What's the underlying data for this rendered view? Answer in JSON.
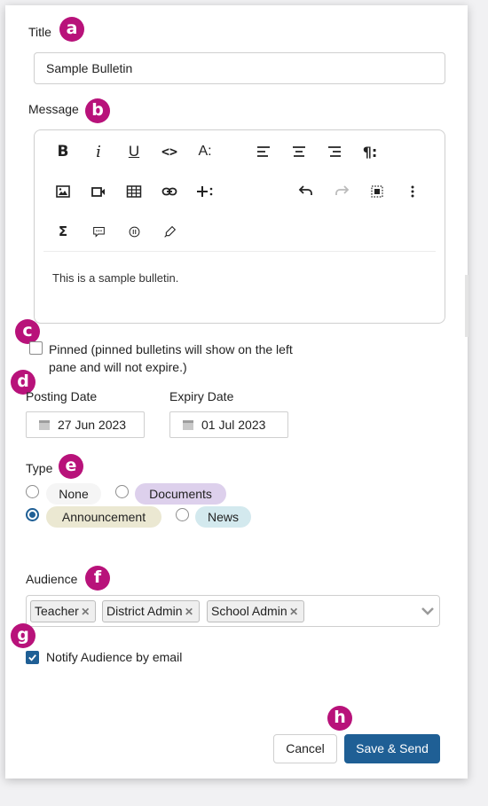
{
  "markers": [
    "a",
    "b",
    "c",
    "d",
    "e",
    "f",
    "g",
    "h"
  ],
  "title_field": {
    "label": "Title",
    "value": "Sample Bulletin"
  },
  "message": {
    "label": "Message",
    "body": "This is a sample bulletin.",
    "toolbar": [
      {
        "name": "bold-button",
        "icon": "bold-icon",
        "glyph": "B"
      },
      {
        "name": "italic-button",
        "icon": "italic-icon",
        "glyph": "i"
      },
      {
        "name": "underline-button",
        "icon": "underline-icon",
        "glyph": "U"
      },
      {
        "name": "code-button",
        "icon": "code-icon",
        "glyph": "<>"
      },
      {
        "name": "font-size-button",
        "icon": "font-size-icon",
        "glyph": "A:"
      },
      {
        "name": "align-left-button",
        "icon": "align-left-icon"
      },
      {
        "name": "align-center-button",
        "icon": "align-center-icon"
      },
      {
        "name": "align-right-button",
        "icon": "align-right-icon"
      },
      {
        "name": "paragraph-format-button",
        "icon": "paragraph-icon",
        "glyph": "¶:"
      },
      {
        "name": "insert-image-button",
        "icon": "image-icon"
      },
      {
        "name": "insert-video-button",
        "icon": "video-icon"
      },
      {
        "name": "insert-table-button",
        "icon": "table-icon"
      },
      {
        "name": "insert-link-button",
        "icon": "link-icon"
      },
      {
        "name": "insert-more-button",
        "icon": "plus-icon"
      },
      {
        "name": "undo-button",
        "icon": "undo-icon"
      },
      {
        "name": "redo-button",
        "icon": "redo-icon"
      },
      {
        "name": "select-all-button",
        "icon": "select-all-icon"
      },
      {
        "name": "more-options-button",
        "icon": "more-vertical-icon"
      },
      {
        "name": "insert-formula-button",
        "icon": "sigma-icon",
        "glyph": "Σ"
      },
      {
        "name": "comment-button",
        "icon": "comment-icon"
      },
      {
        "name": "special-chars-button",
        "icon": "omega-icon"
      },
      {
        "name": "highlight-button",
        "icon": "marker-icon"
      }
    ]
  },
  "pinned": {
    "checked": false,
    "line1": "Pinned (pinned bulletins will show on the left",
    "line2": "pane and will not expire.)"
  },
  "posting_date": {
    "label": "Posting Date",
    "value": "27 Jun 2023"
  },
  "expiry_date": {
    "label": "Expiry Date",
    "value": "01 Jul 2023"
  },
  "type": {
    "label": "Type",
    "selected": "Announcement",
    "options": [
      {
        "label": "None",
        "color": "#f5f5f5"
      },
      {
        "label": "Documents",
        "color": "#ddd0ec"
      },
      {
        "label": "Announcement",
        "color": "#ebe8d2"
      },
      {
        "label": "News",
        "color": "#d3e9ee"
      }
    ]
  },
  "audience": {
    "label": "Audience",
    "tags": [
      "Teacher",
      "District Admin",
      "School Admin"
    ]
  },
  "notify": {
    "checked": true,
    "label": "Notify Audience by email"
  },
  "actions": {
    "cancel": "Cancel",
    "save": "Save & Send"
  },
  "colors": {
    "marker": "#b8127a",
    "primary": "#1f5f95"
  }
}
